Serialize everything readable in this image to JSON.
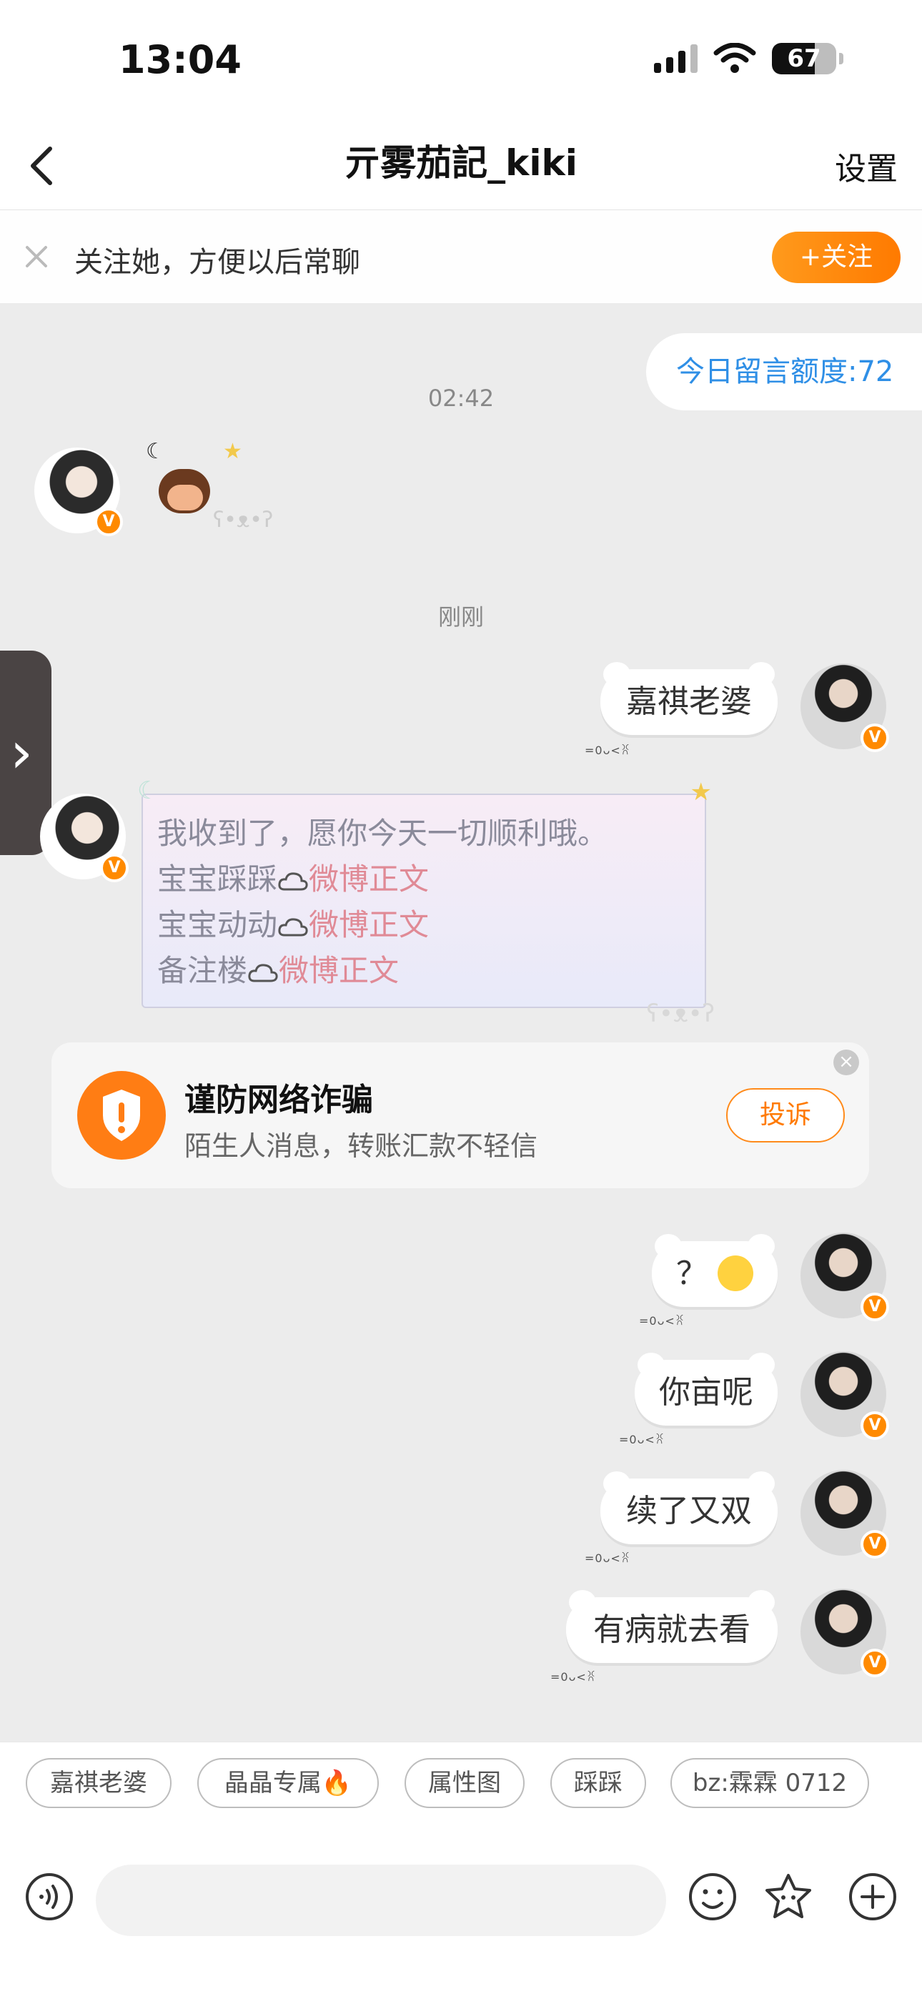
{
  "status_bar": {
    "time": "13:04",
    "battery": "67",
    "battery_level": 0.67
  },
  "nav": {
    "title": "亓雾茄記_kiki",
    "settings_label": "设置"
  },
  "follow_bar": {
    "text": "关注她，方便以后常聊",
    "button_label": "+关注"
  },
  "quota": {
    "label": "今日留言额度:72"
  },
  "timestamps": [
    "02:42",
    "刚刚"
  ],
  "messages": {
    "m1": "嘉祺老婆",
    "m2": "？",
    "m3": "你亩呢",
    "m4": "续了又双",
    "m5": "有病就去看",
    "bubble_tag": "=0ᴗ<ꐦ"
  },
  "framed_message": {
    "line1": "我收到了，愿你今天一切顺利哦。",
    "line2_prefix": "宝宝踩踩",
    "line3_prefix": "宝宝动动",
    "line4_prefix": "备注楼",
    "link": "微博正文"
  },
  "scam_warning": {
    "title": "谨防网络诈骗",
    "subtitle": "陌生人消息，转账汇款不轻信",
    "report_label": "投诉"
  },
  "quick_replies": [
    "嘉祺老婆",
    "晶晶专属🔥",
    "属性图",
    "踩踩",
    "bz:霖霖 0712"
  ],
  "input": {
    "placeholder": ""
  },
  "colors": {
    "accent": "#ff7a00",
    "quota_blue": "#2f8fe6",
    "link_pink": "#e08a96"
  }
}
